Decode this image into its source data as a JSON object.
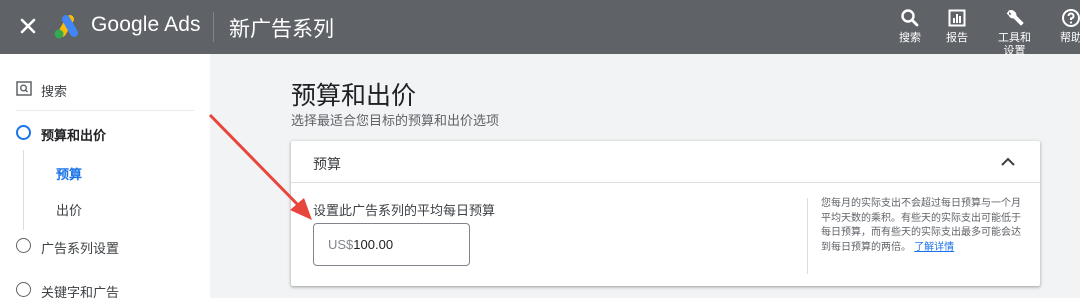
{
  "header": {
    "brand": "Google Ads",
    "title": "新广告系列",
    "tools": [
      {
        "icon": "search-icon",
        "label": "搜索"
      },
      {
        "icon": "report-icon",
        "label": "报告"
      },
      {
        "icon": "wrench-icon",
        "label": "工具和",
        "label2": "设置"
      },
      {
        "icon": "help-icon",
        "label": "帮助"
      }
    ]
  },
  "sidebar": {
    "search": "搜索",
    "items": [
      {
        "label": "预算和出价",
        "active": true
      },
      {
        "label": "广告系列设置"
      },
      {
        "label": "关键字和广告"
      }
    ],
    "sub_items": [
      "预算",
      "出价"
    ]
  },
  "main": {
    "title": "预算和出价",
    "subtitle": "选择最适合您目标的预算和出价选项",
    "card": {
      "title": "预算",
      "budget_label": "设置此广告系列的平均每日预算",
      "currency": "US$",
      "amount": "100.00",
      "help_text": "您每月的实际支出不会超过每日预算与一个月平均天数的乘积。有些天的实际支出可能低于每日预算，而有些天的实际支出最多可能会达到每日预算的两倍。",
      "help_link": "了解详情"
    }
  },
  "colors": {
    "topbar": "#5f6368",
    "accent": "#1a73e8",
    "annotation_arrow": "#e8453c"
  }
}
